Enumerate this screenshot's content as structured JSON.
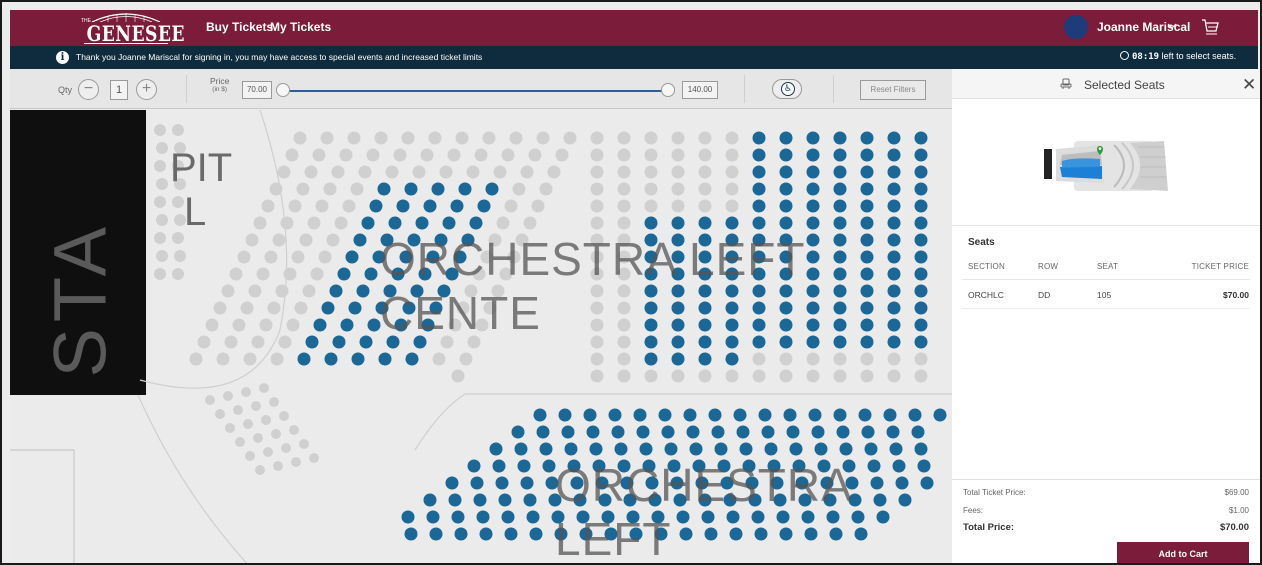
{
  "header": {
    "logo_text": "GENESEE",
    "logo_small": "THE",
    "nav_links": [
      "Buy Tickets",
      "My Tickets"
    ],
    "user_name": "Joanne Mariscal",
    "colors": {
      "nav_bg": "#7a1c3a",
      "info_bg": "#0f2b3e",
      "seat_available": "#1b6796",
      "seat_unavailable": "#d0d0d0"
    }
  },
  "info_bar": {
    "message": "Thank you Joanne Mariscal for signing in, you may have access to special events and increased ticket limits",
    "timer_value": "08:19",
    "timer_suffix": "left to select seats."
  },
  "filters": {
    "qty_label": "Qty",
    "qty_value": "1",
    "price_label": "Price",
    "price_unit": "(in $)",
    "price_min": "70.00",
    "price_max": "140.00",
    "reset_label": "Reset Filters"
  },
  "map": {
    "stage_label": "STA",
    "pit_label": "PIT",
    "pit_label_2": "L",
    "section_labels": [
      "ORCHESTRA LEFT CENTE",
      "ORCHESTRA LEFT"
    ]
  },
  "panel": {
    "title": "Selected Seats",
    "seats_heading": "Seats",
    "columns": [
      "SECTION",
      "ROW",
      "SEAT",
      "TICKET PRICE"
    ],
    "rows": [
      {
        "section": "ORCHLC",
        "row": "DD",
        "seat": "105",
        "price": "$70.00"
      }
    ],
    "totals": {
      "ticket_label": "Total Ticket Price:",
      "ticket_value": "$69.00",
      "fees_label": "Fees:",
      "fees_value": "$1.00",
      "total_label": "Total Price:",
      "total_value": "$70.00"
    },
    "add_to_cart": "Add to Cart"
  }
}
